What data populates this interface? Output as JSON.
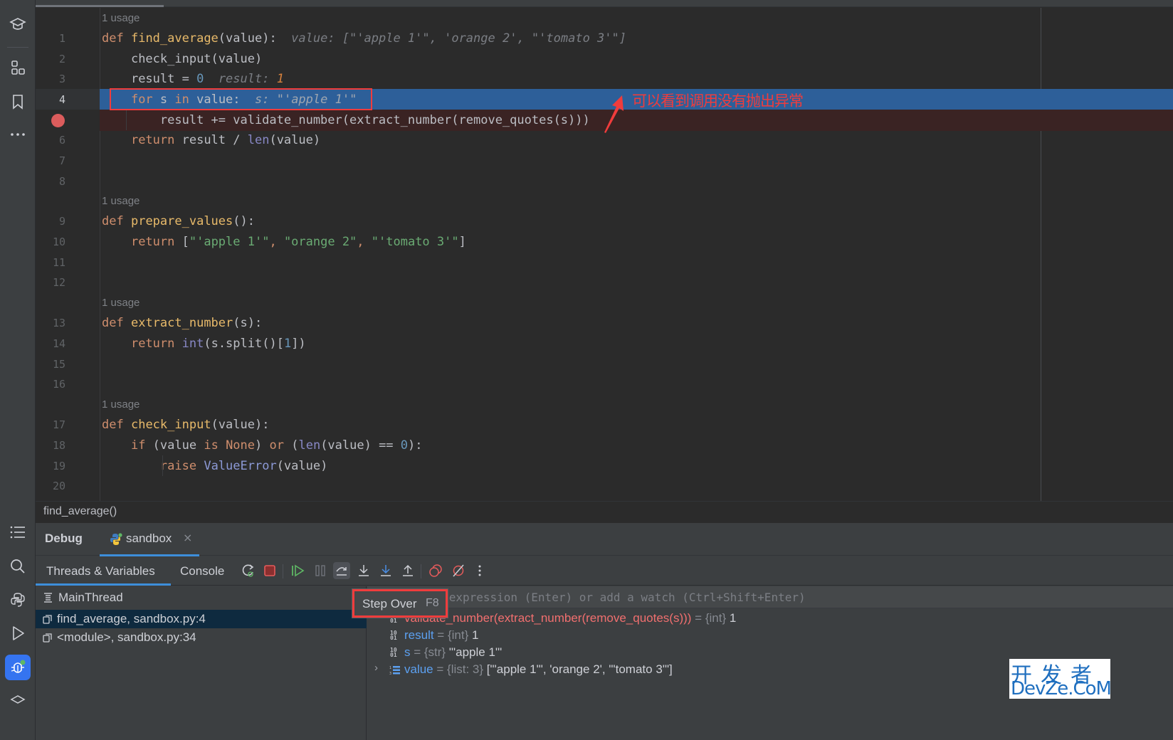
{
  "editor": {
    "usage_label": "1 usage",
    "lines": [
      {
        "n": "1"
      },
      {
        "n": "2"
      },
      {
        "n": "3"
      },
      {
        "n": "4"
      },
      {
        "n": "5"
      },
      {
        "n": "6"
      },
      {
        "n": "7"
      },
      {
        "n": "8"
      },
      {
        "n": "9"
      },
      {
        "n": "10"
      },
      {
        "n": "11"
      },
      {
        "n": "12"
      },
      {
        "n": "13"
      },
      {
        "n": "14"
      },
      {
        "n": "15"
      },
      {
        "n": "16"
      },
      {
        "n": "17"
      },
      {
        "n": "18"
      },
      {
        "n": "19"
      },
      {
        "n": "20"
      }
    ],
    "code": {
      "l1": {
        "kw": "def",
        "fn": "find_average",
        "rest": "(value):",
        "hint": "value: [\"'apple 1'\", 'orange 2', \"'tomato 3'\"]"
      },
      "l2": "check_input(value)",
      "l3": {
        "pre": "result = ",
        "num": "0",
        "hint": "result: ",
        "hint_num": "1"
      },
      "l4": {
        "kw1": "for",
        "mid1": " s ",
        "kw2": "in",
        "mid2": " value:",
        "hint": "s: \"'apple 1'\""
      },
      "l5": "result += validate_number(extract_number(remove_quotes(s)))",
      "l6": {
        "kw": "return",
        "mid": " result / ",
        "builtin": "len",
        "rest": "(value)"
      },
      "l9": {
        "kw": "def",
        "fn": "prepare_values",
        "rest": "():"
      },
      "l10": {
        "kw": "return",
        "open": " [",
        "s1": "\"'apple 1'\"",
        "c1": ", ",
        "s2": "\"orange 2\"",
        "c2": ", ",
        "s3": "\"'tomato 3'\"",
        "close": "]"
      },
      "l13": {
        "kw": "def",
        "fn": "extract_number",
        "rest": "(s):"
      },
      "l14": {
        "kw": "return",
        "builtin": "int",
        "mid": "(s.split()[",
        "num": "1",
        "close": "])"
      },
      "l17": {
        "kw": "def",
        "fn": "check_input",
        "rest": "(value):"
      },
      "l18": {
        "kw_if": "if",
        "p1": " (value ",
        "kw_is": "is",
        "sp": " ",
        "kw_none": "None",
        "p2": ") ",
        "kw_or": "or",
        "p3": " (",
        "builtin": "len",
        "p4": "(value) == ",
        "num": "0",
        "p5": "):"
      },
      "l19": {
        "kw": "raise",
        "cls": "ValueError",
        "rest": "(value)"
      }
    },
    "current_line": 4,
    "breakpoint_line": 5,
    "annotation": "可以看到调用没有抛出异常",
    "breadcrumb": "find_average()"
  },
  "debug": {
    "title": "Debug",
    "session_tab": "sandbox",
    "close_glyph": "×",
    "subtabs": [
      "Threads & Variables",
      "Console"
    ],
    "toolbar": [
      "rerun-icon",
      "stop-icon",
      "resume-icon",
      "pause-icon",
      "step-over-icon",
      "step-into-icon",
      "step-into-my-code-icon",
      "step-out-icon",
      "view-breakpoints-icon",
      "mute-breakpoints-icon",
      "more-icon"
    ],
    "thread": "MainThread",
    "frames": [
      "find_average, sandbox.py:4",
      "<module>, sandbox.py:34"
    ],
    "watch_placeholder": "Evaluate expression (Enter) or add a watch (Ctrl+Shift+Enter)",
    "variables": [
      {
        "name": "validate_number(extract_number(remove_quotes(s)))",
        "eq": " = ",
        "type": "{int}",
        "value": " 1"
      },
      {
        "name": "result",
        "eq": " = ",
        "type": "{int}",
        "value": " 1"
      },
      {
        "name": "s",
        "eq": " = ",
        "type": "{str}",
        "value": " \"'apple 1'\""
      },
      {
        "name": "value",
        "eq": " = ",
        "type": "{list: 3}",
        "value": " [\"'apple 1'\", 'orange 2', \"'tomato 3'\"]"
      }
    ],
    "tooltip": {
      "label": "Step Over",
      "shortcut": "F8"
    }
  },
  "watermark": {
    "line1": "开发者",
    "line2": "DevZe.CoM"
  },
  "colors": {
    "accent": "#3574f0",
    "current_line": "#2d5f99",
    "breakpoint_line": "#3a2323",
    "annotation": "#f03c3c"
  }
}
